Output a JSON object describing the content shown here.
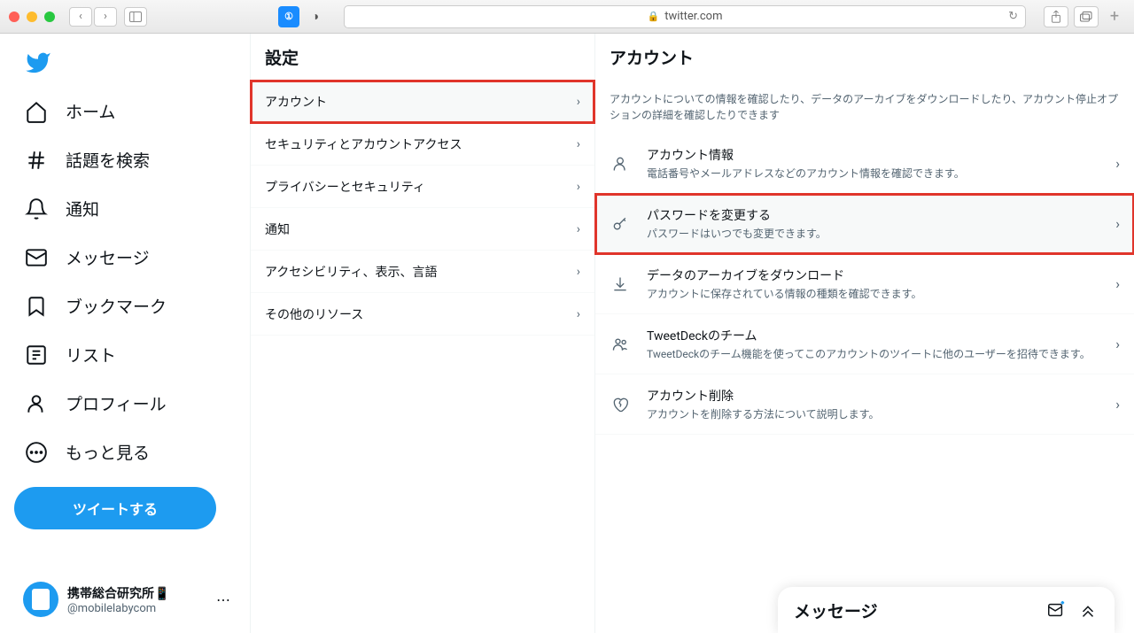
{
  "browser": {
    "url": "twitter.com"
  },
  "nav": {
    "items": [
      {
        "label": "ホーム"
      },
      {
        "label": "話題を検索"
      },
      {
        "label": "通知"
      },
      {
        "label": "メッセージ"
      },
      {
        "label": "ブックマーク"
      },
      {
        "label": "リスト"
      },
      {
        "label": "プロフィール"
      },
      {
        "label": "もっと見る"
      }
    ],
    "tweet_button": "ツイートする"
  },
  "profile": {
    "name": "携帯総合研究所📱",
    "handle": "@mobilelabycom"
  },
  "settings": {
    "header": "設定",
    "items": [
      "アカウント",
      "セキュリティとアカウントアクセス",
      "プライバシーとセキュリティ",
      "通知",
      "アクセシビリティ、表示、言語",
      "その他のリソース"
    ]
  },
  "detail": {
    "header": "アカウント",
    "description": "アカウントについての情報を確認したり、データのアーカイブをダウンロードしたり、アカウント停止オプションの詳細を確認したりできます",
    "items": [
      {
        "title": "アカウント情報",
        "sub": "電話番号やメールアドレスなどのアカウント情報を確認できます。"
      },
      {
        "title": "パスワードを変更する",
        "sub": "パスワードはいつでも変更できます。"
      },
      {
        "title": "データのアーカイブをダウンロード",
        "sub": "アカウントに保存されている情報の種類を確認できます。"
      },
      {
        "title": "TweetDeckのチーム",
        "sub": "TweetDeckのチーム機能を使ってこのアカウントのツイートに他のユーザーを招待できます。"
      },
      {
        "title": "アカウント削除",
        "sub": "アカウントを削除する方法について説明します。"
      }
    ]
  },
  "message_dock": {
    "title": "メッセージ"
  }
}
